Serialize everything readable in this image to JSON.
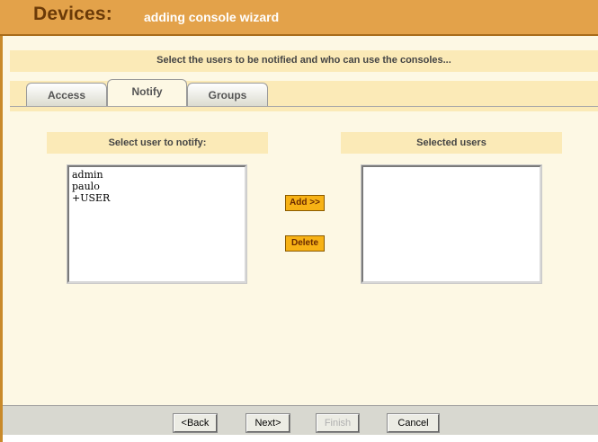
{
  "header": {
    "title": "Devices:",
    "subtitle": "adding console wizard"
  },
  "instruction": "Select the users to be notified and who can use the consoles...",
  "tabs": [
    {
      "label": "Access",
      "active": false
    },
    {
      "label": "Notify",
      "active": true
    },
    {
      "label": "Groups",
      "active": false
    }
  ],
  "left_panel": {
    "label": "Select user to notify:",
    "items": [
      "admin",
      "paulo",
      "+USER"
    ]
  },
  "right_panel": {
    "label": "Selected users",
    "items": []
  },
  "actions": {
    "add_label": "Add >>",
    "delete_label": "Delete"
  },
  "footer": {
    "back_label": "<Back",
    "next_label": "Next>",
    "finish_label": "Finish",
    "cancel_label": "Cancel",
    "finish_enabled": false
  },
  "colors": {
    "header_bg": "#e3a24a",
    "header_title": "#6b3a08",
    "panel_bg": "#fbeab7",
    "content_bg": "#fdf8e4",
    "button_orange": "#f7b215"
  }
}
